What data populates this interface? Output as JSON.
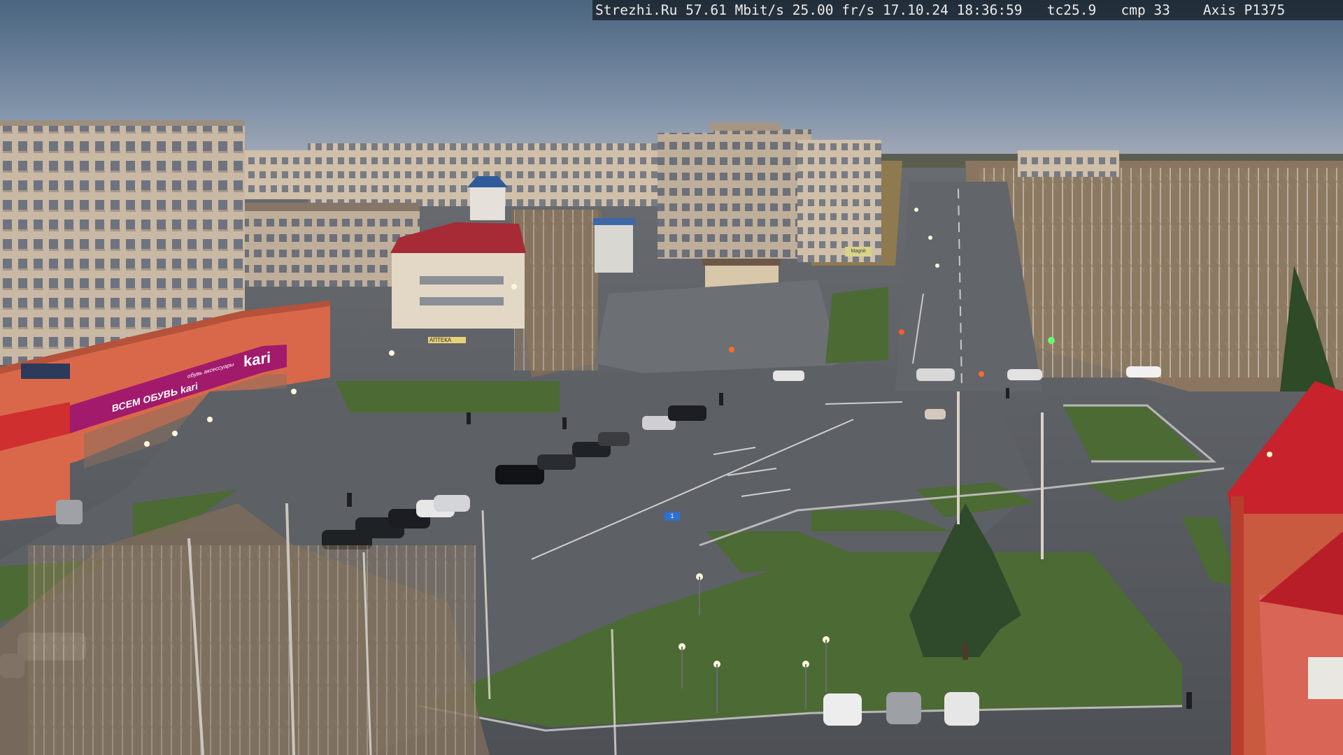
{
  "overlay": {
    "site": "Strezhi.Ru",
    "bitrate": "57.61 Mbit/s",
    "framerate": "25.00 fr/s",
    "date": "17.10.24",
    "time": "18:36:59",
    "tc": "tc25.9",
    "cmp": "cmp 33",
    "camera": "Axis P1375"
  },
  "signs": {
    "store_brand": "kari",
    "store_banner": "ВСЕМ ОБУВЬ kari",
    "store_banner_small": "обувь аксессуары",
    "shop_sign": "АПТЕКА",
    "billboard": "Magnit",
    "street_sign": "1"
  },
  "colors": {
    "sky_top": "#4d6781",
    "sky_bottom": "#9aa6b7",
    "kari_magenta": "#a21a6b",
    "building_orange": "#d9684a",
    "red_roof": "#b52b35",
    "grass": "#4c6a34",
    "asphalt": "#5b5e63"
  }
}
